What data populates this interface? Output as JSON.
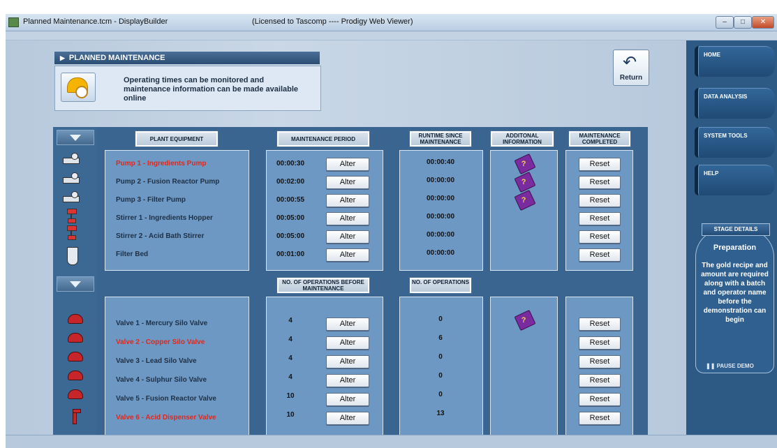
{
  "window": {
    "title": "Planned Maintenance.tcm - DisplayBuilder",
    "license": "(Licensed to Tascomp ---- Prodigy Web Viewer)",
    "buttons": {
      "minimize": "–",
      "maximize": "□",
      "close": "✕"
    }
  },
  "header": {
    "title": "PLANNED MAINTENANCE",
    "description": "Operating times can be monitored and maintenance information can be made available online"
  },
  "return_button": {
    "label": "Return"
  },
  "top_table": {
    "columns": [
      "PLANT EQUIPMENT",
      "MAINTENANCE PERIOD",
      "RUNTIME SINCE MAINTENANCE",
      "ADDITONAL INFORMATION",
      "MAINTENANCE COMPLETED"
    ],
    "rows": [
      {
        "name": "Pump 1 - Ingredients Pump",
        "highlight": true,
        "period": "00:00:30",
        "runtime": "00:00:40",
        "info": true
      },
      {
        "name": "Pump 2 - Fusion Reactor Pump",
        "highlight": false,
        "period": "00:02:00",
        "runtime": "00:00:00",
        "info": true
      },
      {
        "name": "Pump 3 - Filter Pump",
        "highlight": false,
        "period": "00:00:55",
        "runtime": "00:00:00",
        "info": true
      },
      {
        "name": "Stirrer 1 - Ingredients Hopper",
        "highlight": false,
        "period": "00:05:00",
        "runtime": "00:00:00",
        "info": false
      },
      {
        "name": "Stirrer 2 - Acid Bath Stirrer",
        "highlight": false,
        "period": "00:05:00",
        "runtime": "00:00:00",
        "info": false
      },
      {
        "name": "Filter Bed",
        "highlight": false,
        "period": "00:01:00",
        "runtime": "00:00:00",
        "info": false
      }
    ]
  },
  "bottom_table": {
    "columns": [
      "NO. OF OPERATIONS BEFORE MAINTENANCE",
      "NO. OF OPERATIONS"
    ],
    "rows": [
      {
        "name": "Valve 1 - Mercury Silo Valve",
        "highlight": false,
        "before": "4",
        "ops": "0",
        "info": true
      },
      {
        "name": "Valve 2 - Copper Silo Valve",
        "highlight": true,
        "before": "4",
        "ops": "6",
        "info": false
      },
      {
        "name": "Valve 3 - Lead Silo Valve",
        "highlight": false,
        "before": "4",
        "ops": "0",
        "info": false
      },
      {
        "name": "Valve 4 - Sulphur Silo Valve",
        "highlight": false,
        "before": "4",
        "ops": "0",
        "info": false
      },
      {
        "name": "Valve 5 - Fusion Reactor Valve",
        "highlight": false,
        "before": "10",
        "ops": "0",
        "info": false
      },
      {
        "name": "Valve 6 - Acid Dispenser Valve",
        "highlight": true,
        "before": "10",
        "ops": "13",
        "info": false
      }
    ]
  },
  "buttons": {
    "alter": "Alter",
    "reset": "Reset",
    "info_glyph": "?"
  },
  "sidebar": {
    "items": [
      "HOME",
      "DATA ANALYSIS",
      "SYSTEM TOOLS",
      "HELP"
    ],
    "stage_header": "STAGE DETAILS",
    "stage_title": "Preparation",
    "stage_text": "The gold recipe and amount are required along with a batch and operator name before the demonstration can begin",
    "pause": "❚❚ PAUSE DEMO"
  },
  "colors": {
    "highlight": "#e0281c",
    "panel": "#6d98c3",
    "frame": "#3a6590",
    "sidebar": "#2c5a85"
  },
  "icons": [
    "pump-icon",
    "stirrer-icon",
    "filter-icon",
    "valve-icon",
    "dispenser-icon",
    "book-icon",
    "return-arrow-icon",
    "helmet-clock-icon"
  ]
}
